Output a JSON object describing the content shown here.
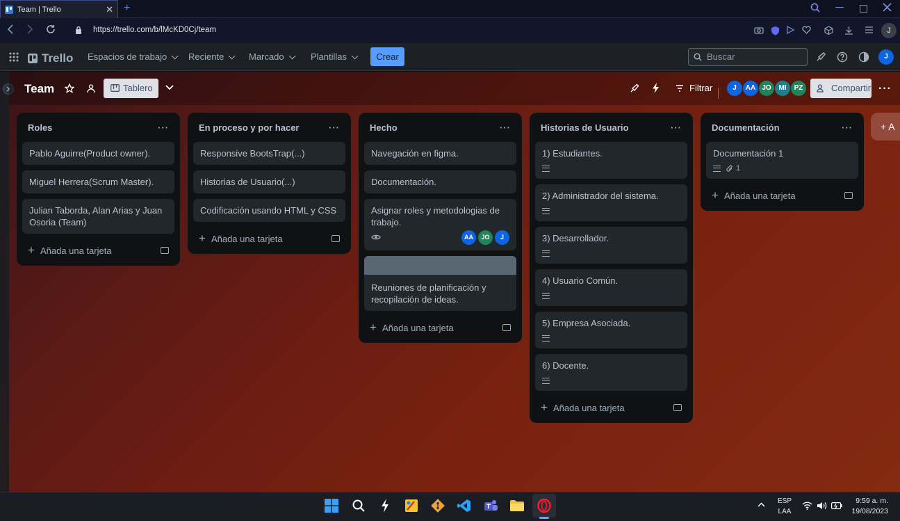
{
  "browser": {
    "tab_title": "Team | Trello",
    "tab_close": "✕",
    "new_tab": "+",
    "url": "https://trello.com/b/lMcKD0Cj/team",
    "profile_initial": "J"
  },
  "header": {
    "logo": "Trello",
    "menus": [
      "Espacios de trabajo",
      "Reciente",
      "Marcado",
      "Plantillas"
    ],
    "create_label": "Crear",
    "search_placeholder": "Buscar",
    "user_initial": "J"
  },
  "board": {
    "title": "Team",
    "view_label": "Tablero",
    "filter_label": "Filtrar",
    "share_label": "Compartir",
    "members": [
      {
        "initials": "J",
        "color": "#0c66e4"
      },
      {
        "initials": "AA",
        "color": "#0c66e4"
      },
      {
        "initials": "JO",
        "color": "#1f845a"
      },
      {
        "initials": "MI",
        "color": "#1d7f8c"
      },
      {
        "initials": "PZ",
        "color": "#1f845a"
      }
    ],
    "add_list_label": "+ A",
    "add_card_label": "Añada una tarjeta",
    "list_menu": "···"
  },
  "lists": [
    {
      "title": "Roles",
      "cards": [
        {
          "text": "Pablo Aguirre(Product owner)."
        },
        {
          "text": "Miguel Herrera(Scrum Master)."
        },
        {
          "text": "Julian Taborda, Alan Arias y Juan Osoria (Team)"
        }
      ]
    },
    {
      "title": "En proceso y por hacer",
      "cards": [
        {
          "text": "Responsive BootsTrap(...)"
        },
        {
          "text": "Historias de Usuario(...)"
        },
        {
          "text": "Codificación usando HTML y CSS"
        }
      ]
    },
    {
      "title": "Hecho",
      "cards": [
        {
          "text": "Navegación en figma."
        },
        {
          "text": "Documentación."
        },
        {
          "text": "Asignar roles y metodologias de trabajo.",
          "members": [
            "AA",
            "JO",
            "J"
          ]
        },
        {
          "text": "Reuniones de planificación y recopilación de ideas.",
          "cover": true
        }
      ]
    },
    {
      "title": "Historias de Usuario",
      "cards": [
        {
          "text": "1) Estudiantes.",
          "description": true
        },
        {
          "text": "2) Administrador del sistema.",
          "description": true
        },
        {
          "text": "3) Desarrollador.",
          "description": true
        },
        {
          "text": "4) Usuario Común.",
          "description": true
        },
        {
          "text": "5) Empresa Asociada.",
          "description": true
        },
        {
          "text": "6) Docente.",
          "description": true
        }
      ]
    },
    {
      "title": "Documentación",
      "cards": [
        {
          "text": "Documentación 1",
          "description": true,
          "attachments": "1"
        }
      ]
    }
  ],
  "taskbar": {
    "lang_top": "ESP",
    "lang_bottom": "LAA",
    "time": "9:59 a. m.",
    "date": "19/08/2023"
  },
  "colors": {
    "accent": "#579dff",
    "board_bg_start": "#3a1418",
    "board_bg_end": "#842a12",
    "list_bg": "#0f1112",
    "card_bg": "#22272b"
  }
}
